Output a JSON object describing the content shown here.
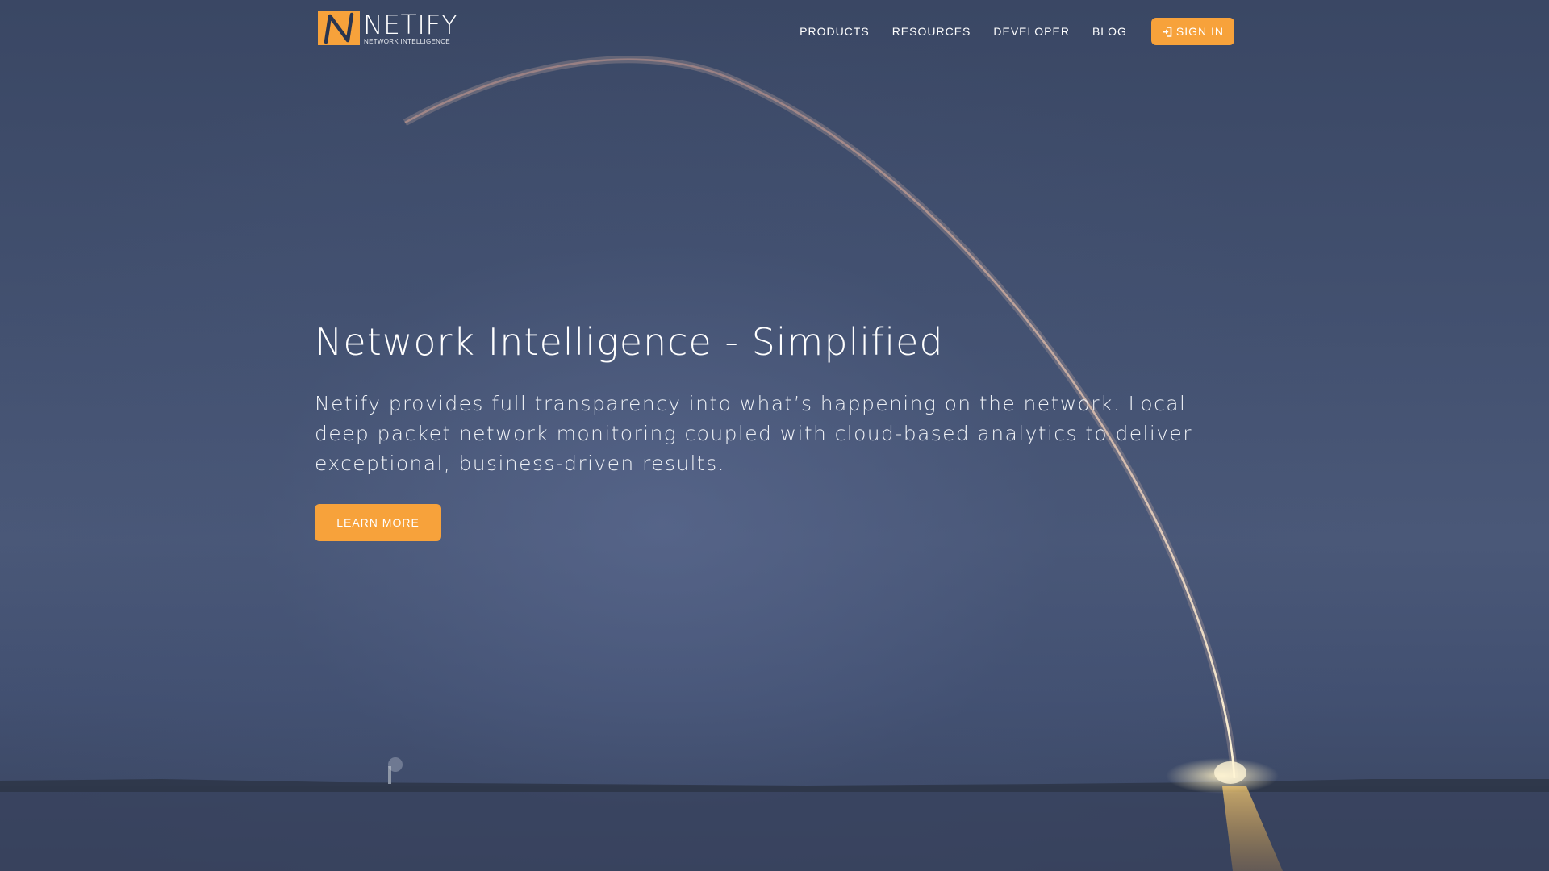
{
  "brand": {
    "name": "NETIFY",
    "tagline": "NETWORK INTELLIGENCE",
    "accent_color": "#f7a23b",
    "logo_icon": "netify-n-logo-icon"
  },
  "nav": {
    "items": [
      {
        "label": "PRODUCTS"
      },
      {
        "label": "RESOURCES"
      },
      {
        "label": "DEVELOPER"
      },
      {
        "label": "BLOG"
      }
    ],
    "signin": {
      "label": "SIGN IN",
      "icon": "sign-in-icon"
    }
  },
  "hero": {
    "title": "Network Intelligence - Simplified",
    "description": "Netify provides full transparency into what’s happening on the network. Local deep packet network monitoring coupled with cloud-based analytics to deliver exceptional, business-driven results.",
    "cta_label": "LEARN MORE",
    "background": "rocket-launch-night-sky-image"
  }
}
